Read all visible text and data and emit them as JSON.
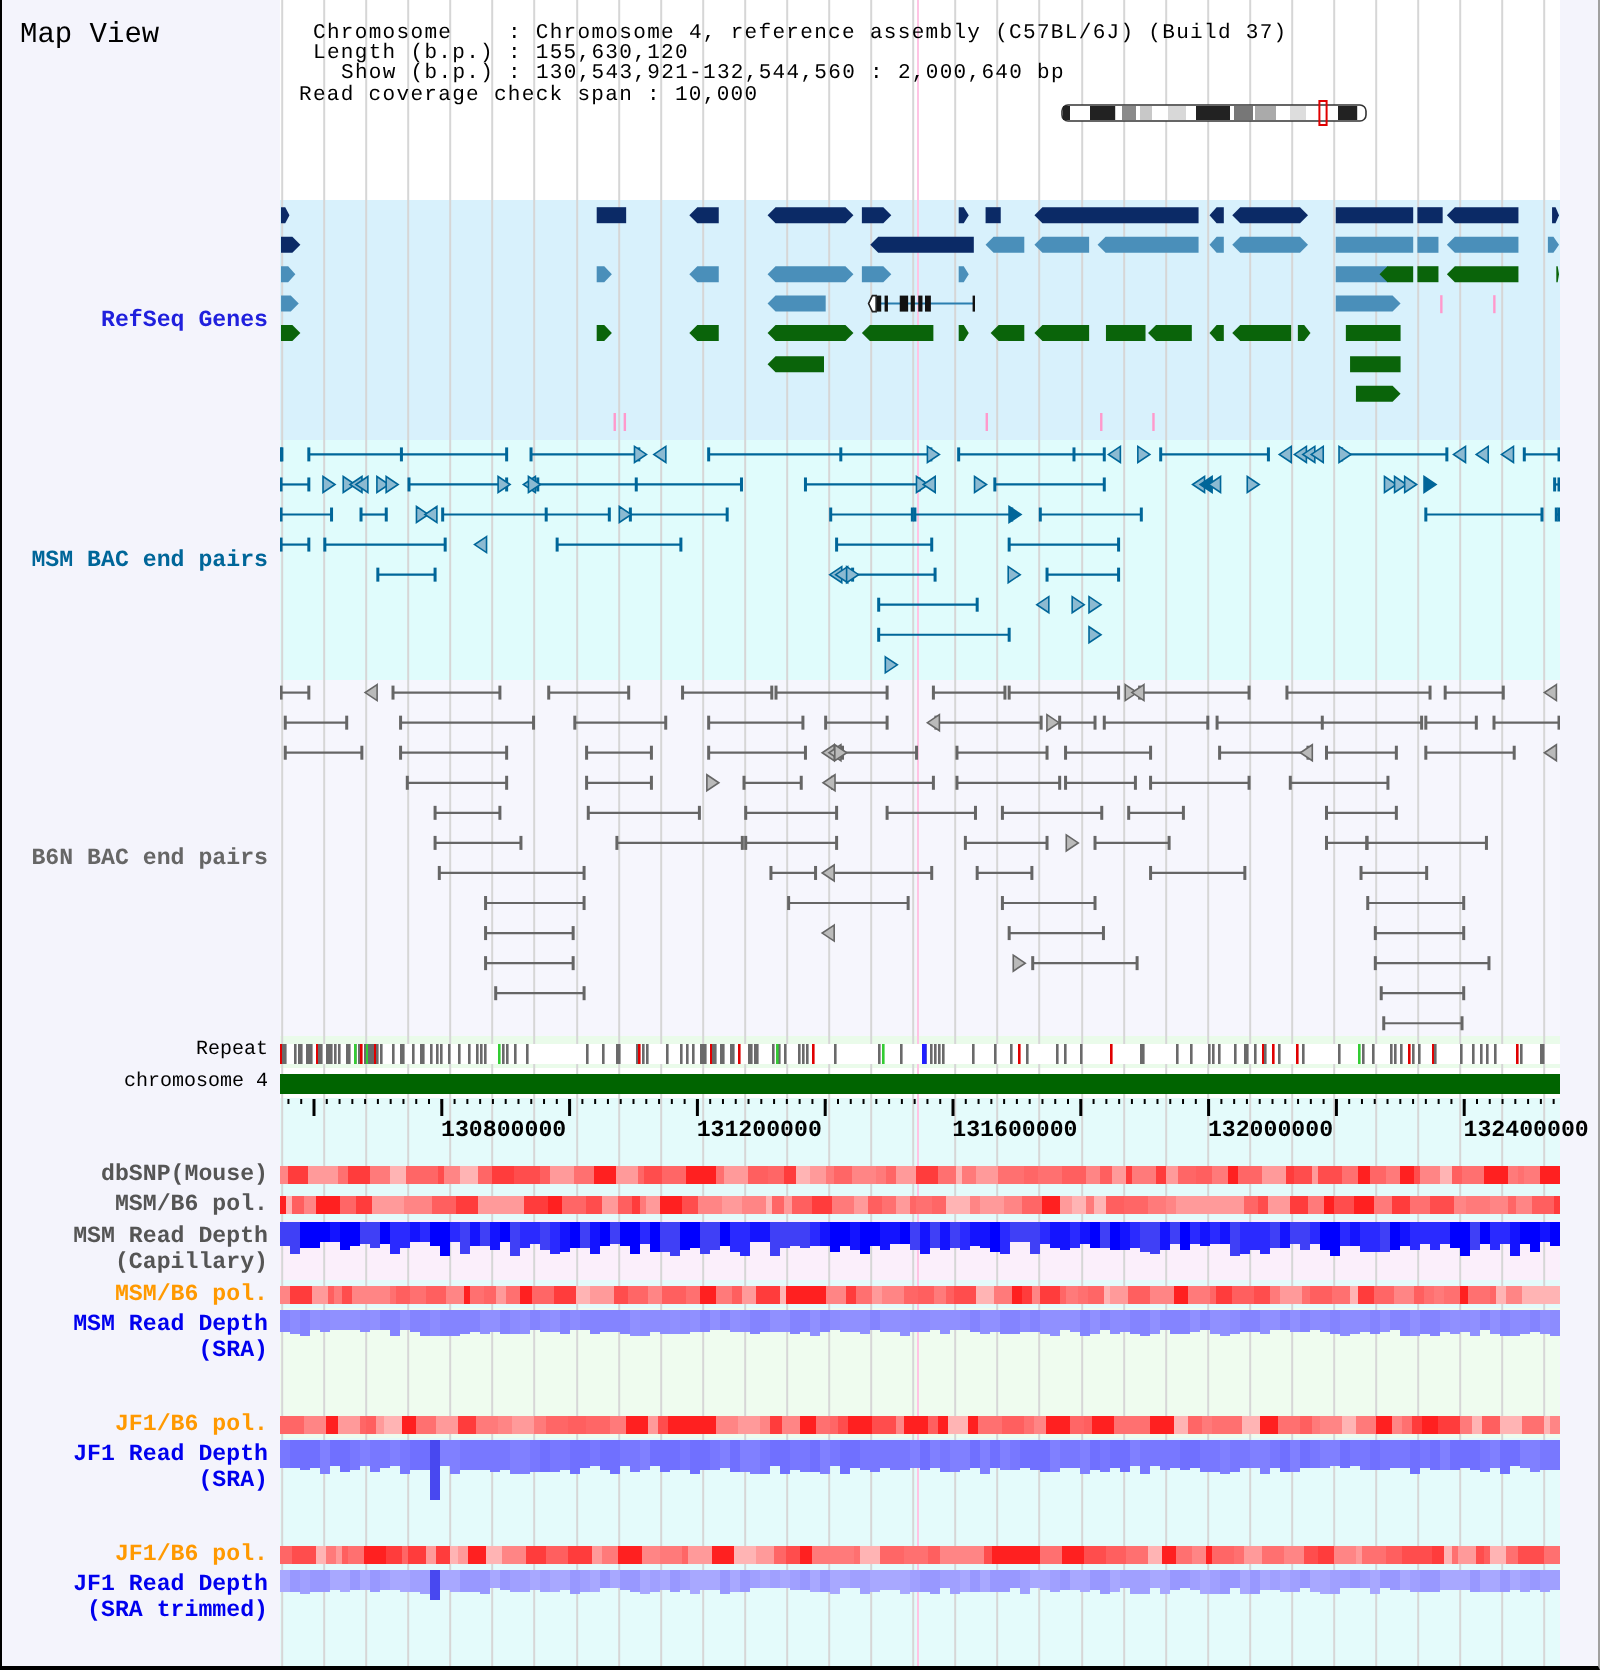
{
  "view": {
    "title": "Map View"
  },
  "info": {
    "lines": [
      "Chromosome    : Chromosome 4, reference assembly (C57BL/6J) (Build 37)",
      "Length (b.p.) : 155,630,120",
      "Show (b.p.) : 130,543,921-132,544,560 : 2,000,640 bp",
      "Read coverage check span : 10,000"
    ]
  },
  "tracks": [
    {
      "label": "RefSeq Genes",
      "kind": "genes",
      "color": "#2020dd"
    },
    {
      "label": "MSM BAC end pairs",
      "kind": "bac_pairs",
      "color": "#006699"
    },
    {
      "label": "B6N BAC end pairs",
      "kind": "bac_pairs",
      "color": "#666666"
    },
    {
      "label": "Repeat",
      "kind": "repeat",
      "color": "#000000"
    },
    {
      "label": "chromosome 4",
      "kind": "chromosome",
      "color": "#000000"
    }
  ],
  "axis": {
    "labels": [
      "130800000",
      "131200000",
      "131600000",
      "132000000",
      "132400000"
    ]
  },
  "data_tracks": [
    {
      "label": "dbSNP(Mouse)",
      "kind": "heat",
      "color": "#555555"
    },
    {
      "label": "MSM/B6 pol.",
      "kind": "heat",
      "color": "#555555"
    },
    {
      "label": "MSM Read Depth (Capillary)",
      "kind": "depth",
      "color": "#555555"
    },
    {
      "label": "MSM/B6 pol.",
      "kind": "heat",
      "color": "#ff9900"
    },
    {
      "label": "MSM Read Depth (SRA)",
      "kind": "depth",
      "color": "#0000ee"
    },
    {
      "label": "JF1/B6 pol.",
      "kind": "heat",
      "color": "#ff9900"
    },
    {
      "label": "JF1 Read Depth (SRA)",
      "kind": "depth",
      "color": "#0000ee"
    },
    {
      "label": "JF1/B6 pol.",
      "kind": "heat",
      "color": "#ff9900"
    },
    {
      "label": "JF1 Read Depth (SRA trimmed)",
      "kind": "depth",
      "color": "#0000ee"
    }
  ]
}
